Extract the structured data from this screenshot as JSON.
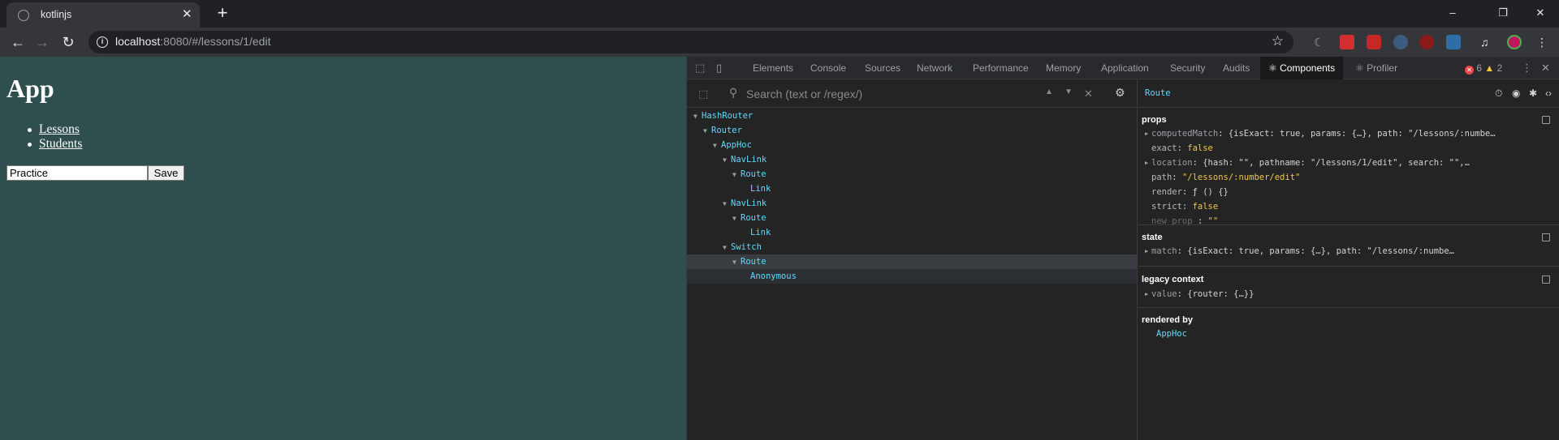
{
  "browser": {
    "tab_title": "kotlinjs",
    "url_host": "localhost",
    "url_rest": ":8080/#/lessons/1/edit",
    "window_controls": [
      "–",
      "❐",
      "✕"
    ]
  },
  "page": {
    "heading": "App",
    "nav_links": [
      "Lessons",
      "Students"
    ],
    "input_value": "Practice",
    "save_label": "Save"
  },
  "devtools": {
    "tabs": [
      "Elements",
      "Console",
      "Sources",
      "Network",
      "Performance",
      "Memory",
      "Application",
      "Security",
      "Audits"
    ],
    "active_tab": "Components",
    "profiler_tab": "Profiler",
    "error_count": "6",
    "warning_count": "2",
    "search_placeholder": "Search (text or /regex/)",
    "tree": [
      {
        "label": "HashRouter",
        "depth": 0,
        "arrow": true
      },
      {
        "label": "Router",
        "depth": 1,
        "arrow": true
      },
      {
        "label": "AppHoc",
        "depth": 2,
        "arrow": true
      },
      {
        "label": "NavLink",
        "depth": 3,
        "arrow": true
      },
      {
        "label": "Route",
        "depth": 4,
        "arrow": true
      },
      {
        "label": "Link",
        "depth": 5,
        "arrow": false
      },
      {
        "label": "NavLink",
        "depth": 3,
        "arrow": true
      },
      {
        "label": "Route",
        "depth": 4,
        "arrow": true
      },
      {
        "label": "Link",
        "depth": 5,
        "arrow": false
      },
      {
        "label": "Switch",
        "depth": 3,
        "arrow": true
      },
      {
        "label": "Route",
        "depth": 4,
        "arrow": true,
        "selected": true
      },
      {
        "label": "Anonymous",
        "depth": 5,
        "arrow": false,
        "hover": true
      }
    ],
    "selected_component": "Route",
    "props_title": "props",
    "props": {
      "computedMatch_key": "computedMatch",
      "computedMatch_val": "{isExact: true, params: {…}, path: \"/lessons/:numbe…",
      "exact_key": "exact",
      "exact_val": "false",
      "location_key": "location",
      "location_val": "{hash: \"\", pathname: \"/lessons/1/edit\", search: \"\",…",
      "path_key": "path",
      "path_val": "\"/lessons/:number/edit\"",
      "render_key": "render",
      "render_val": "ƒ () {}",
      "strict_key": "strict",
      "strict_val": "false",
      "new_prop_key": "new prop",
      "new_prop_val": "\"\""
    },
    "state_title": "state",
    "state": {
      "match_key": "match",
      "match_val": "{isExact: true, params: {…}, path: \"/lessons/:numbe…"
    },
    "legacy_title": "legacy context",
    "legacy": {
      "value_key": "value",
      "value_val": "{router: {…}}"
    },
    "rendered_by_title": "rendered by",
    "rendered_by": "AppHoc"
  }
}
